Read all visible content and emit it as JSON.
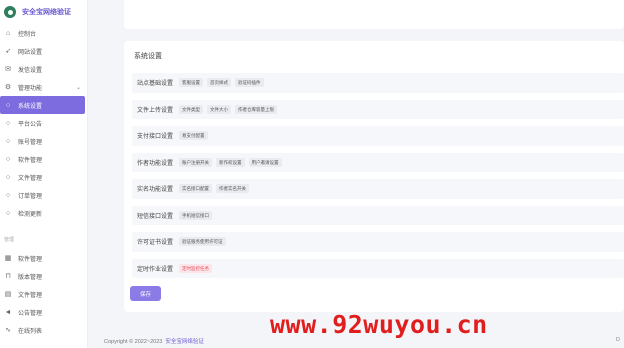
{
  "brand": {
    "name": "安全宝网络验证"
  },
  "sidebar": {
    "items": [
      {
        "label": "控制台",
        "icon": "home-icon"
      },
      {
        "label": "网站设置",
        "icon": "rocket-icon"
      },
      {
        "label": "发信设置",
        "icon": "mail-icon"
      },
      {
        "label": "管理功能",
        "icon": "gear-icon"
      }
    ],
    "sub_items": [
      {
        "label": "系统设置",
        "active": true
      },
      {
        "label": "平台公告"
      },
      {
        "label": "账号管理"
      },
      {
        "label": "软件管理"
      },
      {
        "label": "文件管理"
      },
      {
        "label": "订单管理"
      },
      {
        "label": "检测更新"
      }
    ],
    "group_label": "管理",
    "group_items": [
      {
        "label": "软件管理",
        "icon": "grid-icon"
      },
      {
        "label": "版本管理",
        "icon": "bookmark-icon"
      },
      {
        "label": "文件管理",
        "icon": "file-icon"
      },
      {
        "label": "公告管理",
        "icon": "megaphone-icon"
      },
      {
        "label": "在线列表",
        "icon": "pulse-icon"
      }
    ]
  },
  "main": {
    "title": "系统设置",
    "rows": [
      {
        "title": "站点基础设置",
        "tags": [
          "客服设置",
          "首页样式",
          "验证码插件"
        ]
      },
      {
        "title": "文件上传设置",
        "tags": [
          "文件类型",
          "文件大小",
          "作者仓库容量上限"
        ]
      },
      {
        "title": "支付接口设置",
        "tags": [
          "易支付配置"
        ]
      },
      {
        "title": "作者功能设置",
        "tags": [
          "账户注册开关",
          "新作权设置",
          "用户邀请设置"
        ]
      },
      {
        "title": "实名功能设置",
        "tags": [
          "实名接口配置",
          "作者实名开关"
        ]
      },
      {
        "title": "短信接口设置",
        "tags": [
          "手机短信接口"
        ]
      },
      {
        "title": "许可证书设置",
        "tags": [
          "验证服务使用许可证"
        ]
      },
      {
        "title": "定时作业设置",
        "tags": [
          "定时监控任务"
        ],
        "danger": true
      }
    ],
    "save_label": "保存"
  },
  "footer": {
    "copyright": "Copyright © 2022~2023",
    "link": "安全宝网络验证",
    "right": "D"
  },
  "watermark": "www.92wuyou.cn",
  "colors": {
    "accent": "#7d6be0",
    "danger": "#e0485a",
    "brand_logo": "#2e7d5b"
  }
}
